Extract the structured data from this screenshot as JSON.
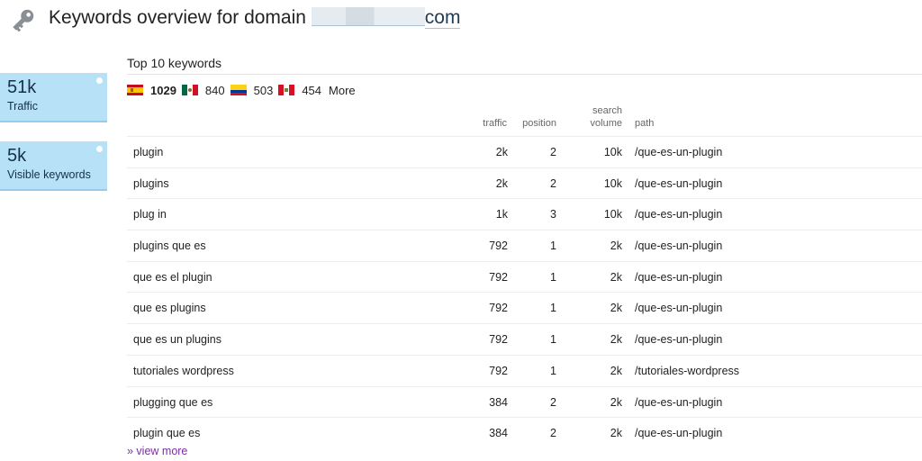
{
  "header": {
    "icon": "key-icon",
    "title": "Keywords overview for domain",
    "domain_suffix": "com"
  },
  "stats": [
    {
      "value": "51k",
      "label": "Traffic"
    },
    {
      "value": "5k",
      "label": "Visible keywords"
    }
  ],
  "section": {
    "title": "Top 10 keywords"
  },
  "countries": [
    {
      "flag": "flag-spain",
      "count": "1029"
    },
    {
      "flag": "flag-mexico",
      "count": "840"
    },
    {
      "flag": "flag-colombia",
      "count": "503"
    },
    {
      "flag": "flag-peru",
      "count": "454"
    }
  ],
  "countries_more": "More",
  "table": {
    "headers": {
      "traffic": "traffic",
      "position": "position",
      "search_volume_1": "search",
      "search_volume_2": "volume",
      "path": "path"
    },
    "rows": [
      {
        "keyword": "plugin",
        "traffic": "2k",
        "position": "2",
        "volume": "10k",
        "path": "/que-es-un-plugin"
      },
      {
        "keyword": "plugins",
        "traffic": "2k",
        "position": "2",
        "volume": "10k",
        "path": "/que-es-un-plugin"
      },
      {
        "keyword": "plug in",
        "traffic": "1k",
        "position": "3",
        "volume": "10k",
        "path": "/que-es-un-plugin"
      },
      {
        "keyword": "plugins que es",
        "traffic": "792",
        "position": "1",
        "volume": "2k",
        "path": "/que-es-un-plugin"
      },
      {
        "keyword": "que es el plugin",
        "traffic": "792",
        "position": "1",
        "volume": "2k",
        "path": "/que-es-un-plugin"
      },
      {
        "keyword": "que es plugins",
        "traffic": "792",
        "position": "1",
        "volume": "2k",
        "path": "/que-es-un-plugin"
      },
      {
        "keyword": "que es un plugins",
        "traffic": "792",
        "position": "1",
        "volume": "2k",
        "path": "/que-es-un-plugin"
      },
      {
        "keyword": "tutoriales wordpress",
        "traffic": "792",
        "position": "1",
        "volume": "2k",
        "path": "/tutoriales-wordpress"
      },
      {
        "keyword": "plugging que es",
        "traffic": "384",
        "position": "2",
        "volume": "2k",
        "path": "/que-es-un-plugin"
      },
      {
        "keyword": "plugin que es",
        "traffic": "384",
        "position": "2",
        "volume": "2k",
        "path": "/que-es-un-plugin"
      }
    ]
  },
  "view_more": "» view more",
  "colors": {
    "stat_bg": "#b7e1f7",
    "link": "#7b2fa3"
  }
}
